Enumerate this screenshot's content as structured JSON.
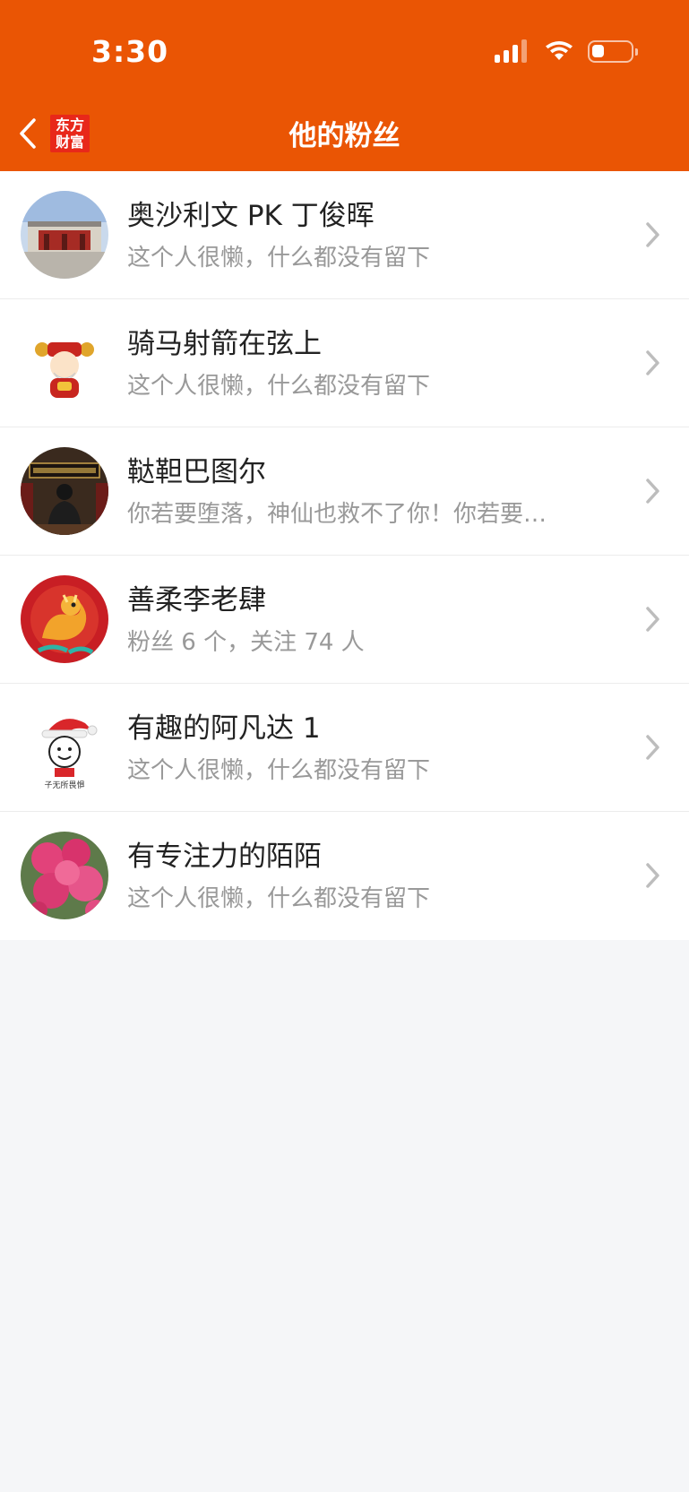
{
  "status_bar": {
    "time": "3:30",
    "icons": [
      "cellular-signal-icon",
      "wifi-icon",
      "battery-icon"
    ],
    "battery_level": 0.3
  },
  "header": {
    "back_icon": "chevron-left-icon",
    "logo_line1": "东方",
    "logo_line2": "财富",
    "title": "他的粉丝",
    "background": "#ea5504"
  },
  "fans": [
    {
      "name": "奥沙利文 PK 丁俊晖",
      "desc": "这个人很懒，什么都没有留下",
      "avatar": "building-photo"
    },
    {
      "name": "骑马射箭在弦上",
      "desc": "这个人很懒，什么都没有留下",
      "avatar": "god-of-wealth-cartoon"
    },
    {
      "name": "鞑靼巴图尔",
      "desc": "你若要堕落，神仙也救不了你！你若要…",
      "avatar": "man-in-hall-photo"
    },
    {
      "name": "善柔李老肆",
      "desc": "粉丝 6 个，关注 74 人",
      "avatar": "dragon-art"
    },
    {
      "name": "有趣的阿凡达 1",
      "desc": "这个人很懒，什么都没有留下",
      "avatar": "santa-hat-smiley",
      "avatar_caption": "子无所畏惧"
    },
    {
      "name": "有专注力的陌陌",
      "desc": "这个人很懒，什么都没有留下",
      "avatar": "pink-blossom-photo"
    }
  ],
  "row_chevron_icon": "chevron-right-icon"
}
